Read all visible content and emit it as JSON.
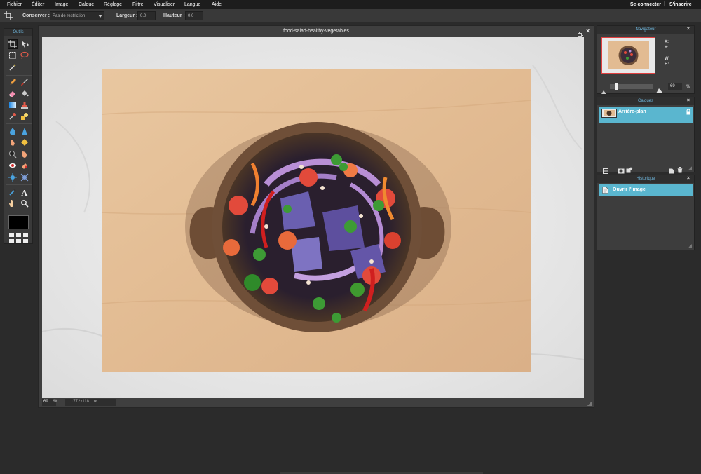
{
  "menu": {
    "items": [
      "Fichier",
      "Éditer",
      "Image",
      "Calque",
      "Réglage",
      "Filtre",
      "Visualiser",
      "Langue",
      "Aide"
    ],
    "login": "Se connecter",
    "signup": "S'inscrire",
    "separator": "|"
  },
  "options": {
    "keep_label": "Conserver :",
    "keep_value": "Pas de restriction",
    "width_label": "Largeur :",
    "width_value": "0.0",
    "height_label": "Hauteur :",
    "height_value": "0.0"
  },
  "tools": {
    "title": "Outils"
  },
  "document": {
    "title": "food-salad-healthy-vegetables",
    "zoom": "69",
    "zoom_unit": "%",
    "dimensions": "1772x1181 px"
  },
  "navigator": {
    "title": "Navigateur",
    "x_label": "X:",
    "y_label": "Y:",
    "w_label": "W:",
    "h_label": "H:",
    "zoom": "69",
    "zoom_unit": "%"
  },
  "layers": {
    "title": "Calques",
    "items": [
      {
        "name": "Arrière-plan"
      }
    ]
  },
  "history": {
    "title": "Historique",
    "items": [
      {
        "name": "Ouvrir l'image"
      }
    ]
  },
  "colors": {
    "accent": "#6fb9e0",
    "selection": "#5ab6cf",
    "foreground": "#000000"
  }
}
